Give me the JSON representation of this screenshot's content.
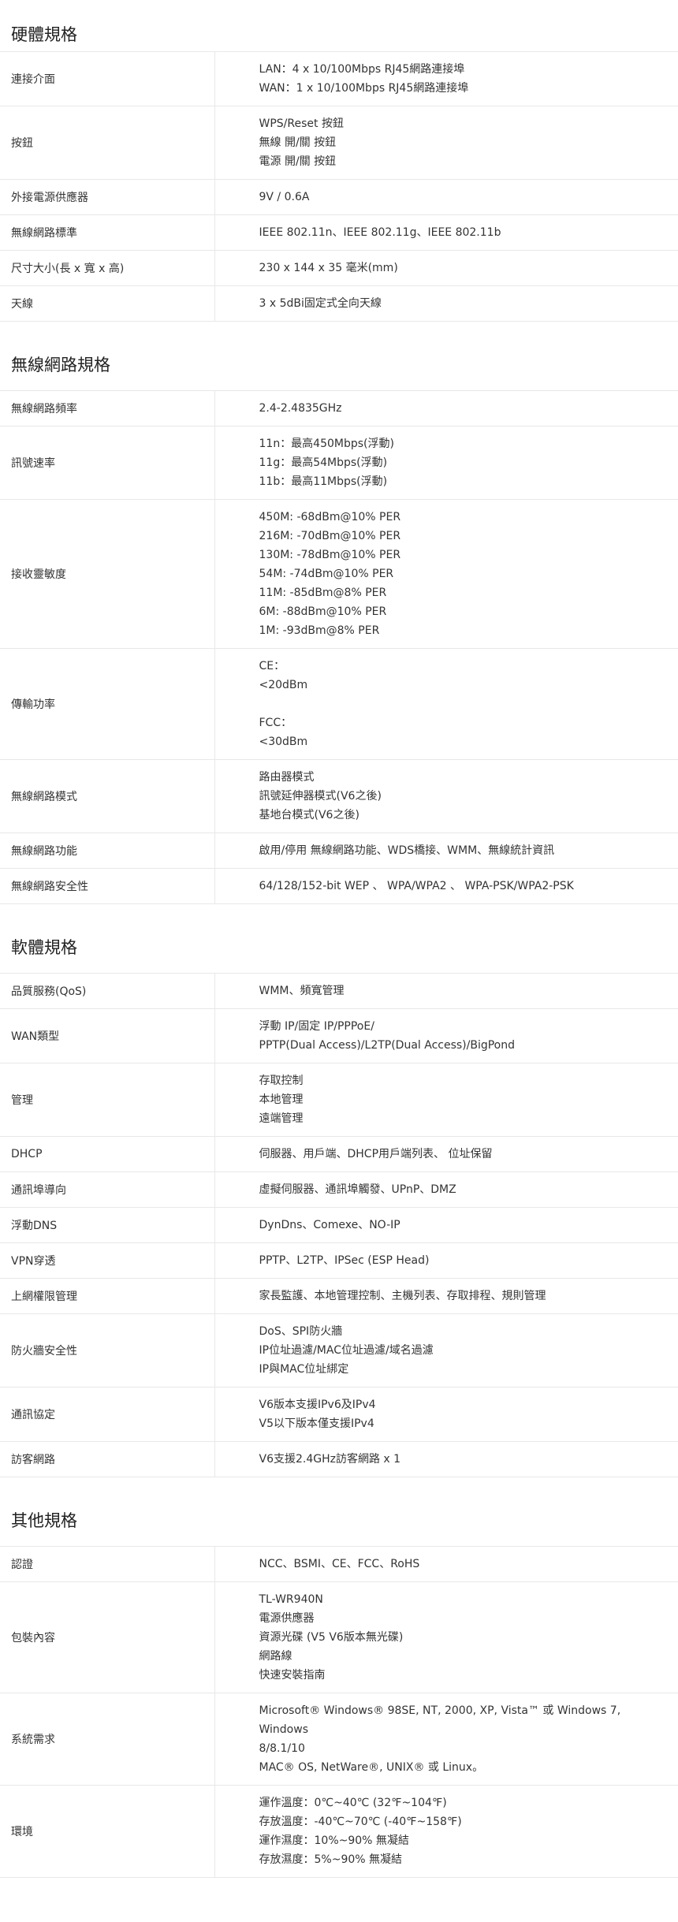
{
  "sections": [
    {
      "title": "硬體規格",
      "rows": [
        {
          "key": "連接介面",
          "lines": [
            "LAN：4 x 10/100Mbps RJ45網路連接埠",
            "WAN：1 x 10/100Mbps RJ45網路連接埠"
          ]
        },
        {
          "key": "按鈕",
          "lines": [
            "WPS/Reset 按鈕",
            "無線 開/關 按鈕",
            "電源 開/關 按鈕"
          ]
        },
        {
          "key": "外接電源供應器",
          "lines": [
            "9V / 0.6A"
          ]
        },
        {
          "key": "無線網路標準",
          "lines": [
            "IEEE 802.11n、IEEE 802.11g、IEEE 802.11b"
          ]
        },
        {
          "key": "尺寸大小(長 x 寬 x 高)",
          "lines": [
            "230 x 144 x 35 毫米(mm)"
          ]
        },
        {
          "key": "天線",
          "lines": [
            "3 x 5dBi固定式全向天線"
          ]
        }
      ]
    },
    {
      "title": "無線網路規格",
      "rows": [
        {
          "key": "無線網路頻率",
          "lines": [
            "2.4-2.4835GHz"
          ]
        },
        {
          "key": "訊號速率",
          "lines": [
            "11n：最高450Mbps(浮動)",
            "11g：最高54Mbps(浮動)",
            "11b：最高11Mbps(浮動)"
          ]
        },
        {
          "key": "接收靈敏度",
          "lines": [
            "450M: -68dBm@10% PER",
            "216M: -70dBm@10% PER",
            "130M: -78dBm@10% PER",
            "54M: -74dBm@10% PER",
            "11M: -85dBm@8% PER",
            "6M: -88dBm@10% PER",
            "1M: -93dBm@8% PER"
          ]
        },
        {
          "key": "傳輸功率",
          "lines": [
            "CE：",
            "<20dBm",
            "",
            "FCC：",
            "<30dBm"
          ]
        },
        {
          "key": "無線網路模式",
          "lines": [
            "路由器模式",
            "訊號延伸器模式(V6之後)",
            "基地台模式(V6之後)"
          ]
        },
        {
          "key": "無線網路功能",
          "lines": [
            "啟用/停用 無線網路功能、WDS橋接、WMM、無線統計資訊"
          ]
        },
        {
          "key": "無線網路安全性",
          "lines": [
            "64/128/152-bit WEP 、 WPA/WPA2 、 WPA-PSK/WPA2-PSK"
          ]
        }
      ]
    },
    {
      "title": "軟體規格",
      "rows": [
        {
          "key": "品質服務(QoS)",
          "lines": [
            "WMM、頻寬管理"
          ]
        },
        {
          "key": "WAN類型",
          "lines": [
            "浮動 IP/固定 IP/PPPoE/",
            "PPTP(Dual Access)/L2TP(Dual Access)/BigPond"
          ]
        },
        {
          "key": "管理",
          "lines": [
            "存取控制",
            "本地管理",
            "遠端管理"
          ]
        },
        {
          "key": "DHCP",
          "lines": [
            "伺服器、用戶端、DHCP用戶端列表、 位址保留"
          ]
        },
        {
          "key": "通訊埠導向",
          "lines": [
            "虛擬伺服器、通訊埠觸發、UPnP、DMZ"
          ]
        },
        {
          "key": "浮動DNS",
          "lines": [
            "DynDns、Comexe、NO-IP"
          ]
        },
        {
          "key": "VPN穿透",
          "lines": [
            "PPTP、L2TP、IPSec (ESP Head)"
          ]
        },
        {
          "key": "上網權限管理",
          "lines": [
            "家長監護、本地管理控制、主機列表、存取排程、規則管理"
          ]
        },
        {
          "key": "防火牆安全性",
          "lines": [
            "DoS、SPI防火牆",
            "IP位址過濾/MAC位址過濾/域名過濾",
            "IP與MAC位址綁定"
          ]
        },
        {
          "key": "通訊協定",
          "lines": [
            "V6版本支援IPv6及IPv4",
            "V5以下版本僅支援IPv4"
          ]
        },
        {
          "key": "訪客網路",
          "lines": [
            "V6支援2.4GHz訪客網路 x 1"
          ]
        }
      ]
    },
    {
      "title": "其他規格",
      "rows": [
        {
          "key": "認證",
          "lines": [
            "NCC、BSMI、CE、FCC、RoHS"
          ]
        },
        {
          "key": "包裝內容",
          "lines": [
            "TL-WR940N",
            "電源供應器",
            "資源光碟 (V5 V6版本無光碟)",
            "網路線",
            "快速安裝指南"
          ]
        },
        {
          "key": "系統需求",
          "lines": [
            "Microsoft® Windows® 98SE, NT, 2000, XP, Vista™ 或 Windows 7, Windows",
            "8/8.1/10",
            "MAC® OS, NetWare®, UNIX® 或 Linux。"
          ]
        },
        {
          "key": "環境",
          "lines": [
            "運作溫度：0℃~40℃ (32℉~104℉)",
            "存放溫度：-40℃~70℃ (-40℉~158℉)",
            "運作濕度：10%~90% 無凝結",
            "存放濕度：5%~90% 無凝結"
          ]
        }
      ]
    }
  ]
}
